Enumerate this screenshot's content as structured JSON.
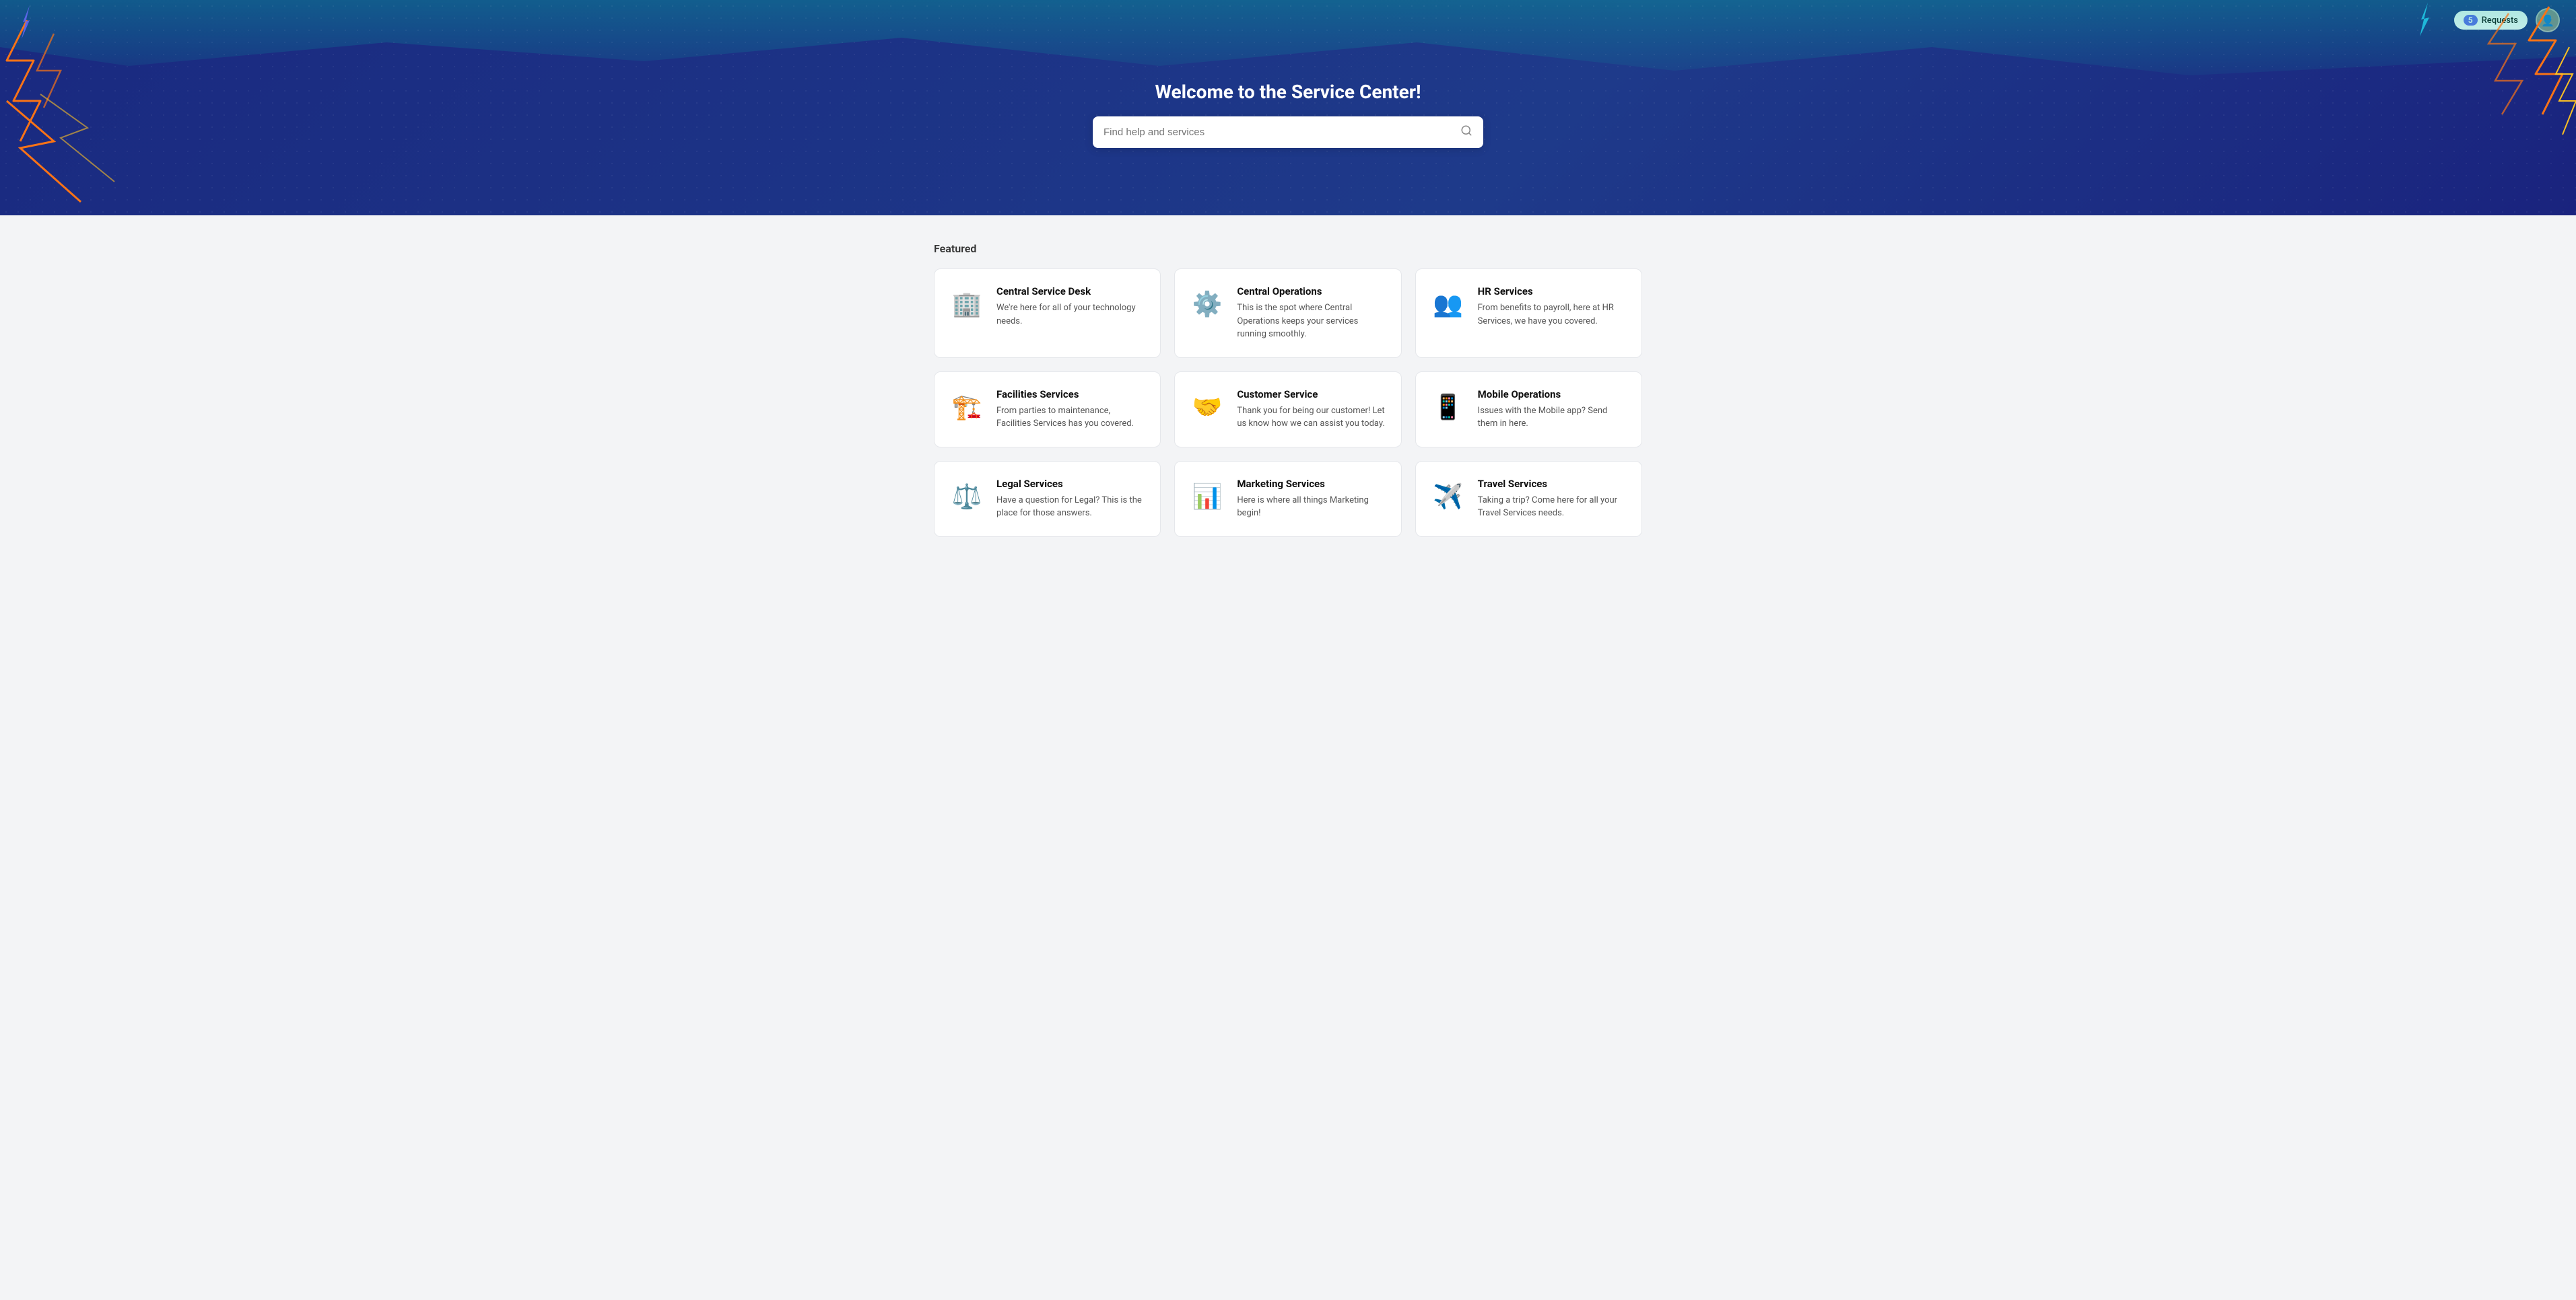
{
  "hero": {
    "title": "Welcome to the Service Center!",
    "search_placeholder": "Find help and services"
  },
  "topnav": {
    "requests_label": "Requests",
    "requests_count": "5"
  },
  "featured": {
    "section_title": "Featured",
    "cards": [
      {
        "id": "central-service-desk",
        "title": "Central Service Desk",
        "desc": "We're here for all of your technology needs.",
        "icon": "🏢"
      },
      {
        "id": "central-operations",
        "title": "Central Operations",
        "desc": "This is the spot where Central Operations keeps your services running smoothly.",
        "icon": "⚙️"
      },
      {
        "id": "hr-services",
        "title": "HR Services",
        "desc": "From benefits to payroll, here at HR Services, we have you covered.",
        "icon": "👥"
      },
      {
        "id": "facilities-services",
        "title": "Facilities Services",
        "desc": "From parties to maintenance, Facilities Services has you covered.",
        "icon": "🏗️"
      },
      {
        "id": "customer-service",
        "title": "Customer Service",
        "desc": "Thank you for being our customer! Let us know how we can assist you today.",
        "icon": "🤝"
      },
      {
        "id": "mobile-operations",
        "title": "Mobile Operations",
        "desc": "Issues with the Mobile app? Send them in here.",
        "icon": "📱"
      },
      {
        "id": "legal-services",
        "title": "Legal Services",
        "desc": "Have a question for Legal? This is the place for those answers.",
        "icon": "⚖️"
      },
      {
        "id": "marketing-services",
        "title": "Marketing Services",
        "desc": "Here is where all things Marketing begin!",
        "icon": "📊"
      },
      {
        "id": "travel-services",
        "title": "Travel Services",
        "desc": "Taking a trip? Come here for all your Travel Services needs.",
        "icon": "✈️"
      }
    ]
  },
  "colors": {
    "hero_bg": "#1a2980",
    "accent": "#6366f1",
    "lightning": "#f97316"
  }
}
